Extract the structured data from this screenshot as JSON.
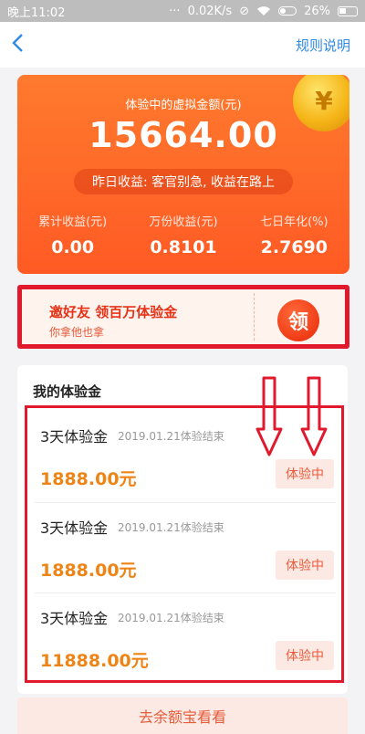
{
  "status_bar": {
    "time": "晚上11:02",
    "network_speed": "0.02K/s",
    "battery_percent": "26%",
    "icons": [
      "dots-icon",
      "mute-icon",
      "wifi-icon",
      "toggle-icon",
      "battery-icon"
    ]
  },
  "nav": {
    "back_icon": "chevron-left-icon",
    "rules_label": "规则说明"
  },
  "summary": {
    "label": "体验中的虚拟金额(元)",
    "amount": "15664.00",
    "yesterday_text": "昨日收益: 客官别急, 收益在路上",
    "coin_glyph": "¥",
    "stats": [
      {
        "label": "累计收益(元)",
        "value": "0.00"
      },
      {
        "label": "万份收益(元)",
        "value": "0.8101"
      },
      {
        "label": "七日年化(%)",
        "value": "2.7690"
      }
    ]
  },
  "invite": {
    "title": "邀好友  领百万体验金",
    "subtitle": "你拿他也拿",
    "claim_label": "领"
  },
  "my_funds": {
    "title": "我的体验金",
    "items": [
      {
        "name": "3天体验金",
        "end_text": "2019.01.21体验结束",
        "amount": "1888.00元",
        "status": "体验中"
      },
      {
        "name": "3天体验金",
        "end_text": "2019.01.21体验结束",
        "amount": "1888.00元",
        "status": "体验中"
      },
      {
        "name": "3天体验金",
        "end_text": "2019.01.21体验结束",
        "amount": "11888.00元",
        "status": "体验中"
      }
    ]
  },
  "bottom_button": {
    "label": "去余额宝看看"
  },
  "colors": {
    "accent_blue": "#2e8ae6",
    "card_orange": "#ff5a24",
    "annotation_red": "#e01a2c",
    "amount_orange": "#ef8416"
  }
}
